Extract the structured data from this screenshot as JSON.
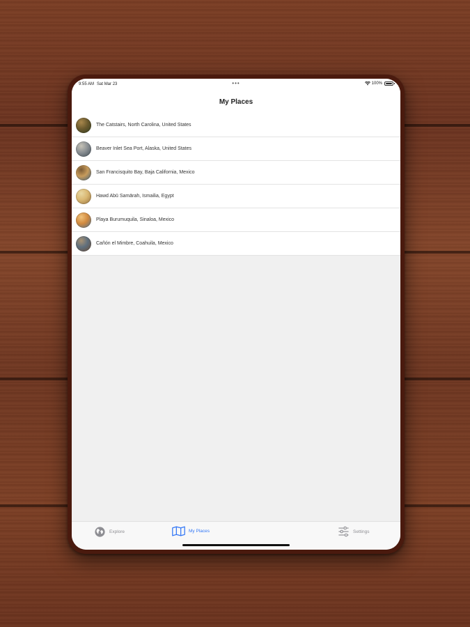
{
  "status_bar": {
    "time": "9:55 AM",
    "date": "Sat Mar 23",
    "battery": "100%",
    "multitask_dots": "•••"
  },
  "nav": {
    "title": "My Places"
  },
  "places": [
    {
      "label": "The Catstairs, North Carolina, United States",
      "thumb": [
        "#6b5a2e",
        "#2f3a1d",
        "#a8874c"
      ]
    },
    {
      "label": "Beaver Inlet Sea Port, Alaska, United States",
      "thumb": [
        "#8a8f93",
        "#3e4a52",
        "#c6c2b6"
      ]
    },
    {
      "label": "San Francisquito Bay, Baja California, Mexico",
      "thumb": [
        "#c79b5b",
        "#3b5d7a",
        "#7a5a34"
      ]
    },
    {
      "label": "Hawd Abū Samārah, Ismailia, Egypt",
      "thumb": [
        "#d9b772",
        "#8f6b39",
        "#e8d7a2"
      ]
    },
    {
      "label": "Playa Burumuquila, Sinaloa, Mexico",
      "thumb": [
        "#d28a3f",
        "#4a6f8f",
        "#f0c27b"
      ]
    },
    {
      "label": "Cañón el Mimbre, Coahuila, Mexico",
      "thumb": [
        "#5f6f7d",
        "#6b4b32",
        "#a89274"
      ]
    }
  ],
  "tabs": {
    "explore": "Explore",
    "my_places": "My Places",
    "settings": "Settings"
  },
  "colors": {
    "accent": "#3478f6",
    "inactive": "#8e8e93",
    "device_frame": "#4a1a0e",
    "wood": "#7a3d24"
  },
  "icons": {
    "explore": "globe-icon",
    "my_places": "map-icon",
    "settings": "sliders-icon"
  }
}
